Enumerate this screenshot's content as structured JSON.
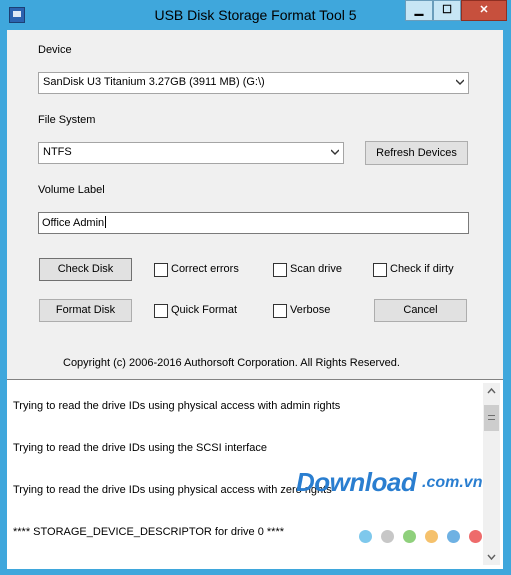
{
  "window": {
    "title": "USB Disk Storage Format Tool 5",
    "min_glyph": "▁",
    "max_glyph": "☐",
    "close_glyph": "✕"
  },
  "device": {
    "label": "Device",
    "selected": "SanDisk U3 Titanium 3.27GB (3911 MB)  (G:\\)"
  },
  "filesystem": {
    "label": "File System",
    "selected": "NTFS",
    "refresh_button": "Refresh Devices"
  },
  "volume": {
    "label": "Volume Label",
    "value": "Office Admin"
  },
  "actions": {
    "check_disk": "Check Disk",
    "format_disk": "Format Disk",
    "cancel": "Cancel"
  },
  "options": {
    "correct_errors": {
      "label": "Correct errors",
      "checked": false
    },
    "scan_drive": {
      "label": "Scan drive",
      "checked": false
    },
    "check_if_dirty": {
      "label": "Check if dirty",
      "checked": false
    },
    "quick_format": {
      "label": "Quick Format",
      "checked": false
    },
    "verbose": {
      "label": "Verbose",
      "checked": false
    }
  },
  "copyright": "Copyright (c) 2006-2016 Authorsoft Corporation. All Rights Reserved.",
  "log": {
    "lines": [
      "Trying to read the drive IDs using physical access with admin rights",
      "Trying to read the drive IDs using the SCSI interface",
      "Trying to read the drive IDs using physical access with zero rights",
      "**** STORAGE_DEVICE_DESCRIPTOR for drive 0 ****"
    ]
  },
  "watermark": {
    "brand": "Download",
    "suffix": ".com.vn",
    "dot_colors": [
      "#7ec8ec",
      "#c7c7c7",
      "#8fd07c",
      "#f5c16c",
      "#6eb1e3",
      "#ee6b6b"
    ]
  },
  "colors": {
    "titlebar": "#3fa7dc",
    "close_button": "#c7503d",
    "watermark": "#2a7ed0"
  }
}
